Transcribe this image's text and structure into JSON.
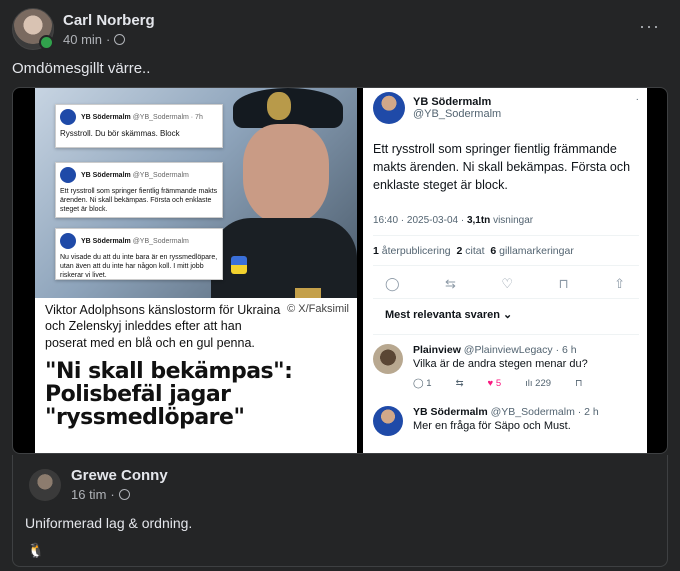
{
  "post": {
    "author": "Carl Norberg",
    "time": "40 min",
    "separator": "·",
    "text": "Omdömesgillt värre..",
    "more_label": "···"
  },
  "left_image": {
    "small_tweet1": {
      "name": "YB Södermalm",
      "handle": "@YB_Sodermalm · 7h",
      "text": "Rysstroll. Du bör skämmas. Block"
    },
    "small_tweet2": {
      "name": "YB Södermalm",
      "handle": "@YB_Sodermalm",
      "text": "Ett rysstroll som springer fientlig främmande makts ärenden. Ni skall bekämpas. Första och enklaste steget är block."
    },
    "small_tweet3": {
      "name": "YB Södermalm",
      "handle": "@YB_Sodermalm",
      "text": "Nu visade du att du inte bara är en ryssmedlöpare, utan även att du inte har någon koll. I mitt jobb riskerar vi livet."
    },
    "caption": "Viktor Adolphsons känslostorm för Ukraina och Zelenskyj inleddes efter att han poserat med en blå och en gul penna.",
    "credit": "© X/Faksimil",
    "headline": "\"Ni skall bekämpas\": Polisbefäl jagar \"ryssmedlöpare\""
  },
  "right_image": {
    "name": "YB Södermalm",
    "handle": "@YB_Sodermalm",
    "dots": "·",
    "text": "Ett rysstroll som springer fientlig främmande makts ärenden. Ni skall bekämpas. Första och enklaste steget är block.",
    "date": "16:40 · 2025-03-04 · ",
    "views_count": "3,1tn",
    "views_label": " visningar",
    "stats": {
      "reposts": "1",
      "reposts_label": " återpublicering",
      "quotes": "2",
      "quotes_label": " citat",
      "likes": "6",
      "likes_label": " gillamarkeringar"
    },
    "most_relevant": "Mest relevanta svaren",
    "reply1": {
      "name": "Plainview",
      "handle": "@PlainviewLegacy · 6 h",
      "text": "Vilka är de andra stegen menar du?",
      "comments": "1",
      "likes": "5",
      "views": "229"
    },
    "reply2": {
      "name": "YB Södermalm",
      "handle": "@YB_Sodermalm · 2 h",
      "text": "Mer en fråga för Säpo och Must."
    }
  },
  "comment": {
    "author": "Grewe Conny",
    "time": "16 tim",
    "separator": "·",
    "text": "Uniformerad lag & ordning.",
    "emoji": "🐧"
  }
}
